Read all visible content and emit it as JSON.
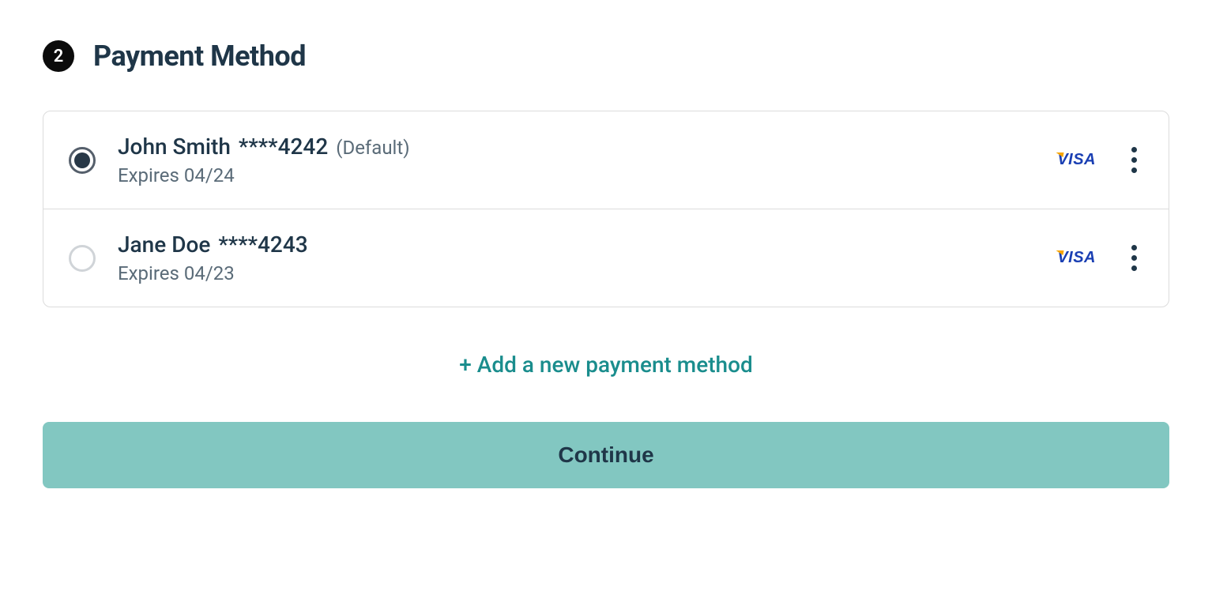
{
  "step": {
    "number": "2",
    "title": "Payment Method"
  },
  "cards": [
    {
      "holder": "John Smith",
      "mask": "****4242",
      "default_label": "(Default)",
      "expires": "Expires 04/24",
      "brand": "VISA",
      "selected": true
    },
    {
      "holder": "Jane Doe",
      "mask": "****4243",
      "default_label": "",
      "expires": "Expires 04/23",
      "brand": "VISA",
      "selected": false
    }
  ],
  "add_label": "+ Add a new payment method",
  "continue_label": "Continue"
}
